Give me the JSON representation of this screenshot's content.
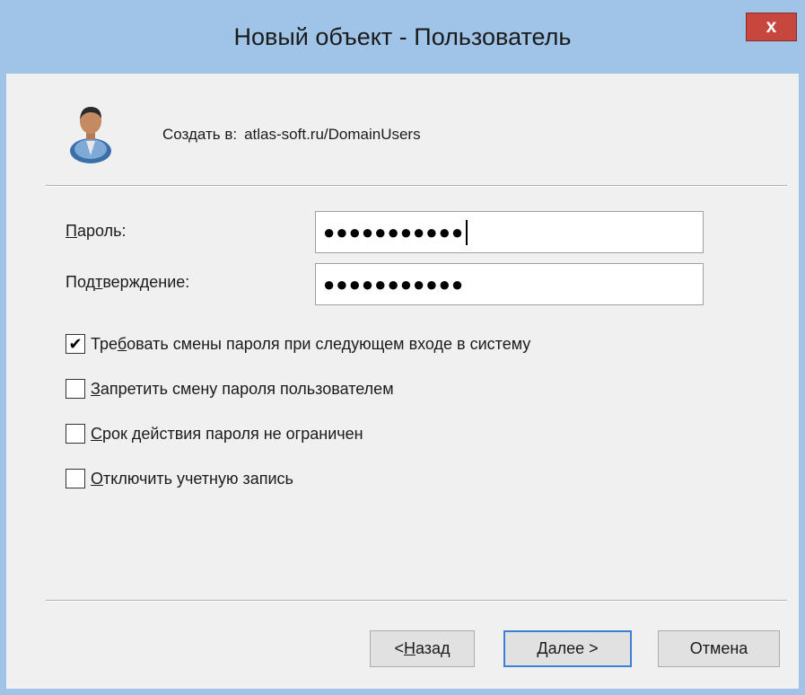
{
  "window": {
    "title": "Новый объект - Пользователь",
    "close_label": "x"
  },
  "header": {
    "icon": "user-icon",
    "create_in_label": "Создать в:",
    "create_in_path": "atlas-soft.ru/DomainUsers"
  },
  "fields": {
    "password": {
      "label_u": "П",
      "label_rest": "ароль:",
      "value": "●●●●●●●●●●●"
    },
    "confirm": {
      "label_pre": "Под",
      "label_u": "т",
      "label_rest": "верждение:",
      "value": "●●●●●●●●●●●"
    }
  },
  "options": [
    {
      "pre": "Тре",
      "u": "б",
      "rest": "овать смены пароля при следующем входе в систему",
      "checked": true
    },
    {
      "pre": "",
      "u": "З",
      "rest": "апретить смену пароля пользователем",
      "checked": false
    },
    {
      "pre": "",
      "u": "С",
      "rest": "рок действия пароля не ограничен",
      "checked": false
    },
    {
      "pre": "",
      "u": "О",
      "rest": "тключить учетную запись",
      "checked": false
    }
  ],
  "checkmark": "✔",
  "buttons": {
    "back": {
      "pre": "< ",
      "u": "Н",
      "rest": "азад"
    },
    "next": {
      "pre": "",
      "u": "Д",
      "rest": "алее >"
    },
    "cancel": {
      "label": "Отмена"
    }
  },
  "colors": {
    "titlebar": "#9fc4e7",
    "close": "#c7463d",
    "default_button_border": "#3c7fd6"
  }
}
